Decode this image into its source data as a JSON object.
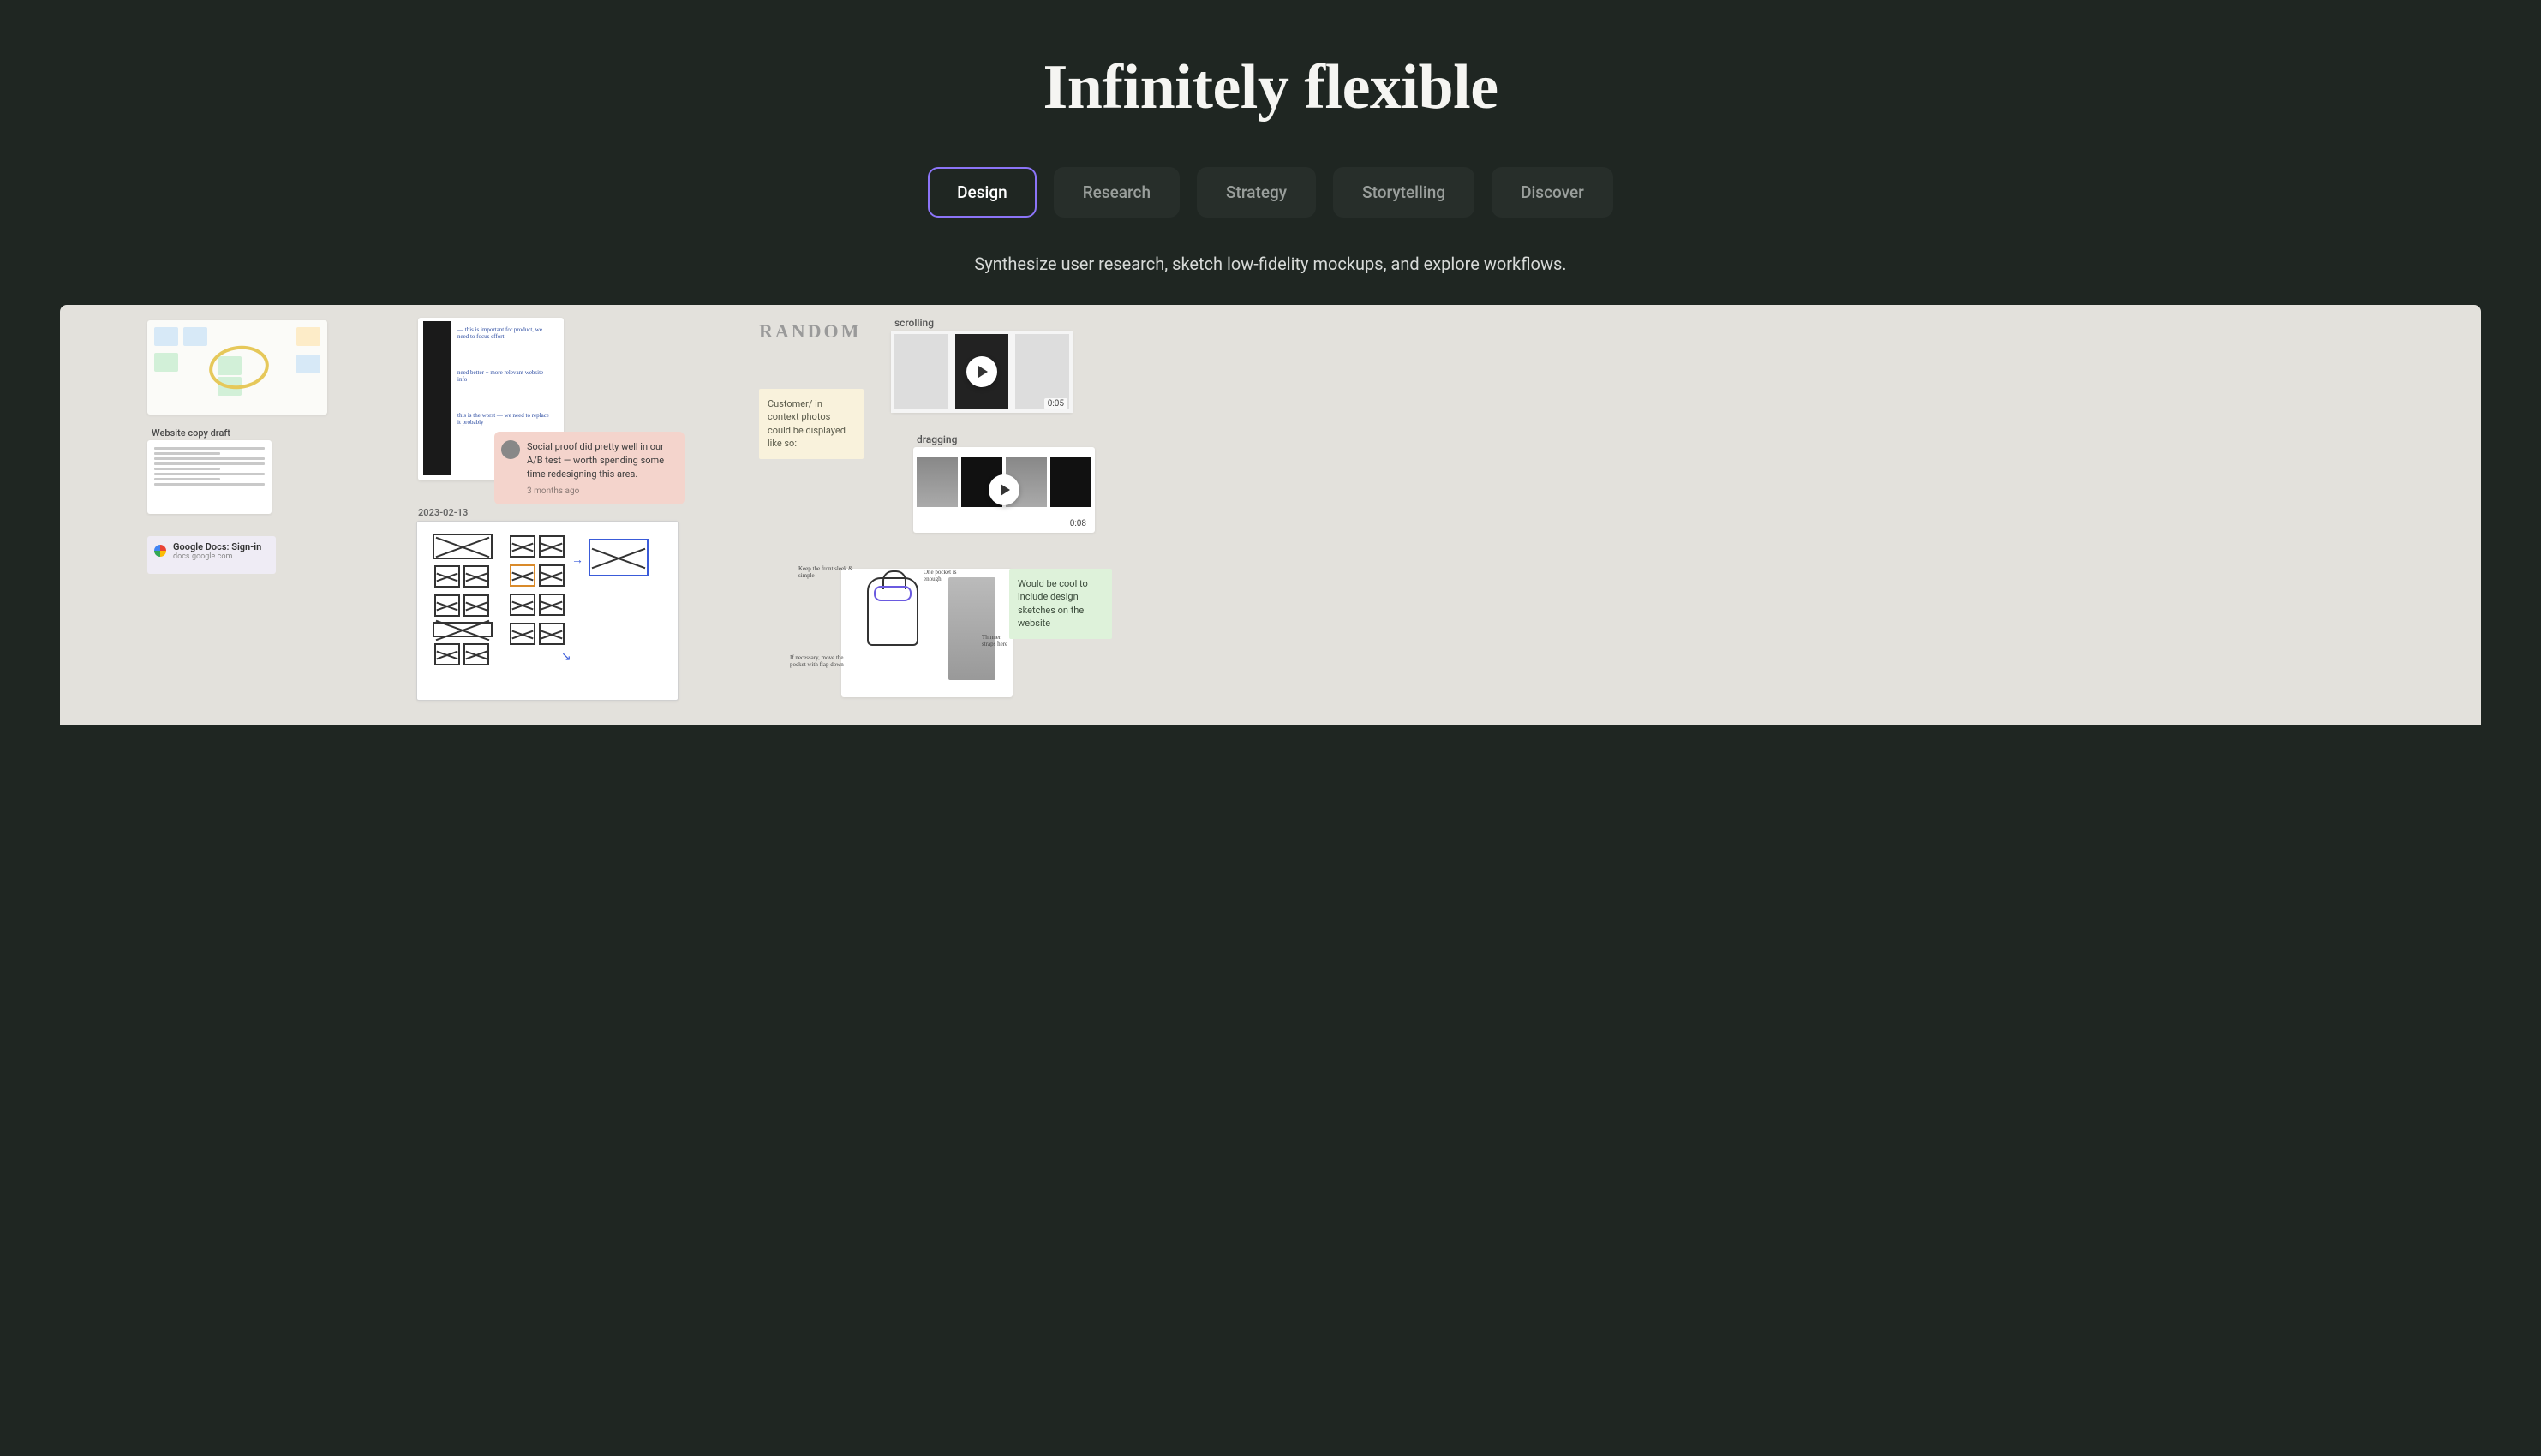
{
  "headline": "Infinitely flexible",
  "tabs": [
    "Design",
    "Research",
    "Strategy",
    "Storytelling",
    "Discover"
  ],
  "active_tab": "Design",
  "subtitle": "Synthesize user research, sketch low-fidelity mockups, and explore workflows.",
  "col1": {
    "copy_label": "Website copy draft",
    "gdocs_title": "Google Docs: Sign-in",
    "gdocs_url": "docs.google.com"
  },
  "col2": {
    "comment_text": "Social proof did pretty well in our A/B test — worth spending some time redesigning this area.",
    "comment_ago": "3 months ago",
    "date": "2023-02-13"
  },
  "col3": {
    "random": "RANDOM",
    "customer_note": "Customer/ in context photos could be displayed like so:",
    "scrolling_label": "scrolling",
    "dragging_label": "dragging",
    "vid1_duration": "0:05",
    "vid2_duration": "0:08",
    "green_note": "Would be cool to include design sketches on the website"
  }
}
